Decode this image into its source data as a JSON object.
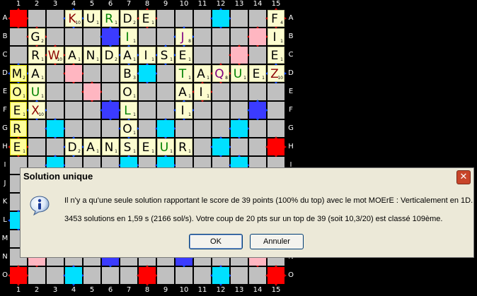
{
  "board": {
    "columns": [
      "1",
      "2",
      "3",
      "4",
      "5",
      "6",
      "7",
      "8",
      "9",
      "10",
      "11",
      "12",
      "13",
      "14",
      "15"
    ],
    "rows": [
      "A",
      "B",
      "C",
      "D",
      "E",
      "F",
      "G",
      "H",
      "I",
      "J",
      "K",
      "L",
      "M",
      "N",
      "O"
    ],
    "colors": {
      "normal": "#c0c0c0",
      "triple_word": "#ff0000",
      "double_word": "#ffb6c1",
      "triple_letter": "#3b3bff",
      "double_letter": "#00e0ff",
      "center": "#ff9fbf"
    },
    "tiles": [
      {
        "r": 0,
        "c": 3,
        "l": "K",
        "v": "10",
        "color": "#8b0000"
      },
      {
        "r": 0,
        "c": 4,
        "l": "U",
        "v": "1",
        "color": "#000000"
      },
      {
        "r": 0,
        "c": 5,
        "l": "R",
        "v": "1",
        "color": "#008000"
      },
      {
        "r": 0,
        "c": 6,
        "l": "D",
        "v": "2",
        "color": "#000000"
      },
      {
        "r": 0,
        "c": 7,
        "l": "E",
        "v": "1",
        "color": "#000000"
      },
      {
        "r": 0,
        "c": 14,
        "l": "F",
        "v": "4",
        "color": "#000000"
      },
      {
        "r": 1,
        "c": 1,
        "l": "G",
        "v": "2",
        "color": "#000000"
      },
      {
        "r": 1,
        "c": 6,
        "l": "I",
        "v": "1",
        "color": "#008000"
      },
      {
        "r": 1,
        "c": 9,
        "l": "J",
        "v": "8",
        "color": "#800080"
      },
      {
        "r": 1,
        "c": 14,
        "l": "I",
        "v": "1",
        "color": "#000000"
      },
      {
        "r": 2,
        "c": 1,
        "l": "R",
        "v": "1",
        "color": "#000000"
      },
      {
        "r": 2,
        "c": 2,
        "l": "W",
        "v": "10",
        "color": "#8b0000"
      },
      {
        "r": 2,
        "c": 3,
        "l": "A",
        "v": "1",
        "color": "#000000"
      },
      {
        "r": 2,
        "c": 4,
        "l": "N",
        "v": "1",
        "color": "#000000"
      },
      {
        "r": 2,
        "c": 5,
        "l": "D",
        "v": "2",
        "color": "#000000"
      },
      {
        "r": 2,
        "c": 6,
        "l": "A",
        "v": "1",
        "color": "#000000"
      },
      {
        "r": 2,
        "c": 7,
        "l": "I",
        "v": "1",
        "color": "#000000"
      },
      {
        "r": 2,
        "c": 8,
        "l": "S",
        "v": "1",
        "color": "#000000"
      },
      {
        "r": 2,
        "c": 9,
        "l": "E",
        "v": "1",
        "color": "#000000"
      },
      {
        "r": 2,
        "c": 14,
        "l": "E",
        "v": "1",
        "color": "#000000"
      },
      {
        "r": 3,
        "c": 0,
        "l": "M",
        "v": "2",
        "color": "#000000",
        "new": true
      },
      {
        "r": 3,
        "c": 1,
        "l": "A",
        "v": "1",
        "color": "#000000"
      },
      {
        "r": 3,
        "c": 6,
        "l": "B",
        "v": "3",
        "color": "#000000"
      },
      {
        "r": 3,
        "c": 9,
        "l": "T",
        "v": "1",
        "color": "#008000"
      },
      {
        "r": 3,
        "c": 10,
        "l": "A",
        "v": "1",
        "color": "#000000"
      },
      {
        "r": 3,
        "c": 11,
        "l": "Q",
        "v": "8",
        "color": "#800080"
      },
      {
        "r": 3,
        "c": 12,
        "l": "U",
        "v": "1",
        "color": "#008000"
      },
      {
        "r": 3,
        "c": 13,
        "l": "E",
        "v": "1",
        "color": "#000000"
      },
      {
        "r": 3,
        "c": 14,
        "l": "Z",
        "v": "10",
        "color": "#8b0000"
      },
      {
        "r": 4,
        "c": 0,
        "l": "O",
        "v": "1",
        "color": "#000000",
        "new": true
      },
      {
        "r": 4,
        "c": 1,
        "l": "U",
        "v": "1",
        "color": "#008000"
      },
      {
        "r": 4,
        "c": 6,
        "l": "O",
        "v": "1",
        "color": "#000000"
      },
      {
        "r": 4,
        "c": 9,
        "l": "A",
        "v": "1",
        "color": "#000000"
      },
      {
        "r": 4,
        "c": 10,
        "l": "I",
        "v": "1",
        "color": "#000000"
      },
      {
        "r": 5,
        "c": 0,
        "l": "E",
        "v": "1",
        "color": "#000000",
        "new": true
      },
      {
        "r": 5,
        "c": 1,
        "l": "X",
        "v": "10",
        "color": "#8b0000"
      },
      {
        "r": 5,
        "c": 6,
        "l": "L",
        "v": "1",
        "color": "#008000"
      },
      {
        "r": 5,
        "c": 9,
        "l": "I",
        "v": "1",
        "color": "#000000"
      },
      {
        "r": 6,
        "c": 0,
        "l": "R",
        "v": "",
        "color": "#000000",
        "new": true
      },
      {
        "r": 6,
        "c": 6,
        "l": "O",
        "v": "1",
        "color": "#000000"
      },
      {
        "r": 7,
        "c": 0,
        "l": "E",
        "v": "1",
        "color": "#000000",
        "new": true
      },
      {
        "r": 7,
        "c": 3,
        "l": "D",
        "v": "2",
        "color": "#000000"
      },
      {
        "r": 7,
        "c": 4,
        "l": "A",
        "v": "1",
        "color": "#000000"
      },
      {
        "r": 7,
        "c": 5,
        "l": "N",
        "v": "1",
        "color": "#000000"
      },
      {
        "r": 7,
        "c": 6,
        "l": "S",
        "v": "1",
        "color": "#000000"
      },
      {
        "r": 7,
        "c": 7,
        "l": "E",
        "v": "1",
        "color": "#000000"
      },
      {
        "r": 7,
        "c": 8,
        "l": "U",
        "v": "1",
        "color": "#008000"
      },
      {
        "r": 7,
        "c": 9,
        "l": "R",
        "v": "1",
        "color": "#000000"
      }
    ]
  },
  "dialog": {
    "title": "Solution unique",
    "close_symbol": "✕",
    "message_line1": "Il n'y a qu'une seule solution rapportant le score de 39 points (100% du top) avec le mot MOErE : Verticalement en 1D.",
    "message_line2": "3453 solutions en 1,59 s (2166 sol/s). Votre coup de 20 pts sur un top de 39 (soit 10,3/20) est classé 109ème.",
    "ok_label": "OK",
    "cancel_label": "Annuler",
    "icon": "info-icon"
  }
}
